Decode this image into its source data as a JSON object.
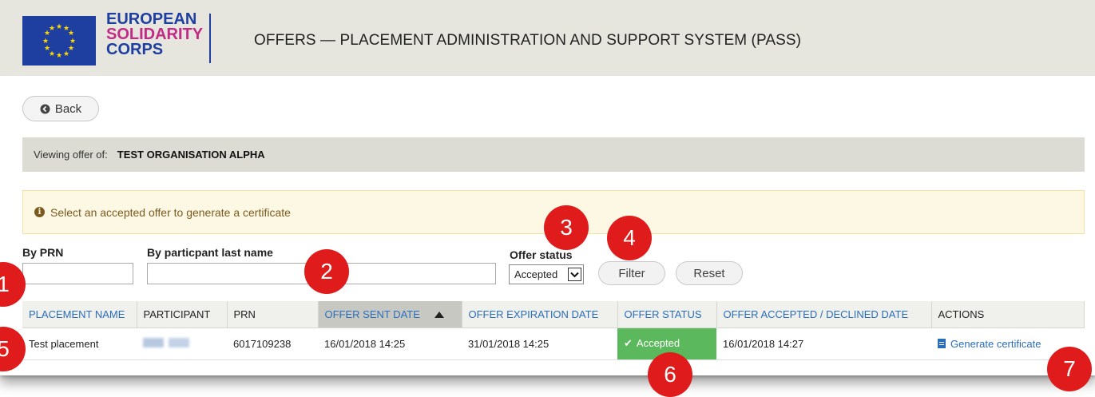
{
  "header": {
    "logo": {
      "line1": "EUROPEAN",
      "line2": "SOLIDARITY",
      "line3": "CORPS"
    },
    "title": "OFFERS — PLACEMENT ADMINISTRATION AND SUPPORT SYSTEM (PASS)",
    "flag_color": "#1f3fa0",
    "star_color": "#ffd700"
  },
  "back_button": {
    "icon": "circle-arrow-left-icon",
    "label": "Back"
  },
  "viewing": {
    "label": "Viewing offer of:",
    "organisation": "TEST ORGANISATION ALPHA"
  },
  "info": {
    "icon": "info-icon",
    "message": "Select an accepted offer to generate a certificate"
  },
  "filters": {
    "prn_label": "By PRN",
    "prn_value": "",
    "lastname_label": "By particpant last name",
    "lastname_value": "",
    "status_label": "Offer status",
    "status_value": "Accepted",
    "filter_button": "Filter",
    "reset_button": "Reset"
  },
  "table": {
    "columns": [
      "PLACEMENT NAME",
      "PARTICIPANT",
      "PRN",
      "OFFER SENT DATE",
      "OFFER EXPIRATION DATE",
      "OFFER STATUS",
      "OFFER ACCEPTED / DECLINED DATE",
      "ACTIONS"
    ],
    "sorted_column": "OFFER SENT DATE",
    "rows": [
      {
        "placement_name": "Test placement",
        "participant": "",
        "prn": "6017109238",
        "sent_date": "16/01/2018 14:25",
        "expiration_date": "31/01/2018 14:25",
        "status": "Accepted",
        "accepted_date": "16/01/2018 14:27",
        "action": "Generate certificate"
      }
    ]
  },
  "colors": {
    "accepted": "#5cb85c",
    "link": "#2a6ebb",
    "badge": "#e01b1b",
    "header_bg": "#e6e6df",
    "info_bg": "#fcf8e3"
  },
  "badges": [
    "1",
    "2",
    "3",
    "4",
    "5",
    "6",
    "7"
  ]
}
